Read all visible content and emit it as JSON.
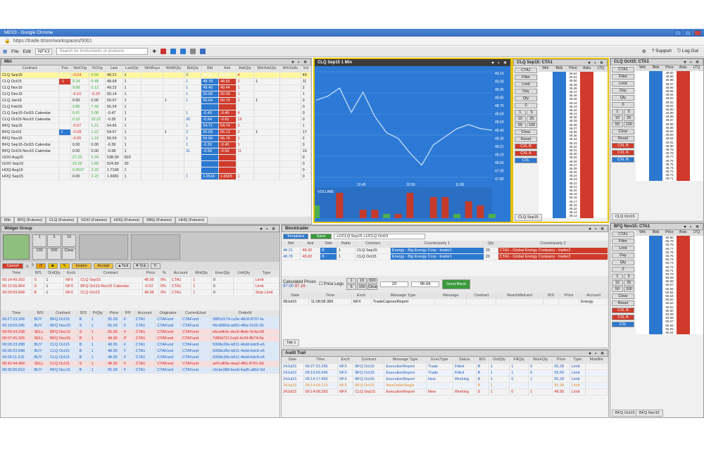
{
  "window": {
    "title": "MEX3 - Google Chrome",
    "url": "https://trade.tt/sim/workspaces/5061"
  },
  "appbar": {
    "menu_file": "File",
    "menu_edit": "Edit",
    "market": "NFX3",
    "search_placeholder": "Search for instruments or products",
    "support": "Support",
    "logout": "Log Out"
  },
  "mkt": {
    "title": "Mkt",
    "headers": [
      "Contract",
      "Pos",
      "NetChg",
      "%Chg",
      "Last",
      "LastQty",
      "WrkBuys",
      "WrkBQty",
      "BidQty",
      "Bid",
      "Ask",
      "AskQty",
      "WrkAskQty",
      "WrkSells",
      "Vol"
    ],
    "rows": [
      [
        "CLQ Sep15",
        "",
        "-0.24",
        "0.50",
        "48.21",
        "1",
        "",
        "",
        "3",
        "48.31",
        "48.34",
        "4",
        "",
        "",
        "40"
      ],
      [
        "CLQ Oct15",
        "-1",
        "0.24",
        "0.49",
        "48.68",
        "1",
        "",
        "",
        "1",
        "48.78",
        "48.82",
        "2",
        "1",
        "",
        "11"
      ],
      [
        "CLQ Nov15",
        "",
        "0.08",
        "0.12",
        "49.32",
        "1",
        "",
        "",
        "1",
        "49.40",
        "49.44",
        "1",
        "",
        "",
        "2"
      ],
      [
        "CLQ Dec15",
        "",
        "-0.10",
        "-0.20",
        "50.14",
        "1",
        "",
        "",
        "1",
        "50.05",
        "50.09",
        "1",
        "",
        "",
        "1"
      ],
      [
        "CLQ Jan16",
        "",
        "0.00",
        "0.00",
        "50.67",
        "1",
        "",
        "1",
        "1",
        "50.64",
        "50.70",
        "1",
        "1",
        "",
        "0"
      ],
      [
        "CLQ Feb16",
        "",
        "3.85",
        "7.49",
        "55.24",
        "1",
        "",
        "",
        "",
        "",
        "",
        "",
        "",
        "",
        "0"
      ],
      [
        "CLQ Sep15-Oct15 Calendar",
        "",
        "0.01",
        "2.08",
        "-0.47",
        "1",
        "",
        "",
        "1",
        "-0.40",
        "-0.40",
        "4",
        "",
        "",
        "0"
      ],
      [
        "CLQ Oct15-Nov15 Calendar",
        "",
        "0.10",
        "22.22",
        "-0.35",
        "1",
        "",
        "",
        "30",
        "-0.64",
        "-0.61",
        "16",
        "",
        "",
        "0"
      ],
      [
        "BFQ Sep15",
        "",
        "-0.07",
        "1.21",
        "54.66",
        "1",
        "",
        "",
        "1",
        "54.71",
        "54.74",
        "2",
        "",
        "",
        "1"
      ],
      [
        "BFQ Oct15",
        "2",
        "-0.08",
        "1.22",
        "54.67",
        "1",
        "",
        "1",
        "2",
        "55.09",
        "55.13",
        "2",
        "1",
        "",
        "17"
      ],
      [
        "BFQ Nov15",
        "",
        "-0.05",
        "1.19",
        "55.55",
        "1",
        "",
        "",
        "1",
        "55.50",
        "55.70",
        "1",
        "",
        "",
        "2"
      ],
      [
        "BFQ Sep15-Oct15 Calendar",
        "",
        "0.00",
        "0.00",
        "-0.39",
        "1",
        "",
        "",
        "1",
        "-0.30",
        "-0.40",
        "1",
        "",
        "",
        "0"
      ],
      [
        "BFQ Oct15-Nov15 Calendar",
        "",
        "0.00",
        "0.00",
        "-0.58",
        "1",
        "",
        "",
        "31",
        "-0.58",
        "-0.56",
        "11",
        "",
        "",
        "15"
      ],
      [
        "GOO Aug15",
        "",
        "27.25",
        "5.34",
        "538.00",
        "503",
        "",
        "",
        "",
        "",
        "",
        "",
        "",
        "",
        "0"
      ],
      [
        "GOO Sep15",
        "",
        "10.25",
        "1.89",
        "524.50",
        "20",
        "",
        "",
        "",
        "",
        "",
        "",
        "",
        "",
        "0"
      ],
      [
        "HOQ Aug15",
        "",
        "0.0537",
        "2.22",
        "1.7199",
        "1",
        "",
        "",
        "",
        "",
        "",
        "",
        "",
        "",
        "0"
      ],
      [
        "HOQ Sep15",
        "",
        "0.00",
        "2.22",
        "1.6081",
        "1",
        "",
        "",
        "1",
        "1.6516",
        "1.6525",
        "1",
        "",
        "",
        "0"
      ]
    ],
    "tabs": [
      "Mkt",
      "BFQ (Futures)",
      "CLQ (Futures)",
      "GOO (Futures)",
      "HOQ (Futures)",
      "RBQ (Futures)",
      "HHQ (Futures)"
    ]
  },
  "chart": {
    "title": "CLQ Sep15 1 Min",
    "ticks": [
      "49.10",
      "49.00",
      "48.90",
      "48.80",
      "48.70",
      "48.60",
      "48.50",
      "48.40",
      "48.30",
      "48.21",
      "48.10",
      "48.00",
      "47.90",
      "47.80"
    ],
    "volume_label": "VOLUME",
    "times": [
      "10:45",
      "10:50",
      "11:00"
    ]
  },
  "chart_data": {
    "type": "line",
    "x": [
      "10:40",
      "10:41",
      "10:42",
      "10:43",
      "10:44",
      "10:45",
      "10:46",
      "10:47",
      "10:48",
      "10:49",
      "10:50",
      "10:51",
      "10:52",
      "10:53",
      "10:54",
      "10:55"
    ],
    "values": [
      48.75,
      48.8,
      48.9,
      48.6,
      48.85,
      48.55,
      48.35,
      48.28,
      48.1,
      47.95,
      48.2,
      48.3,
      48.4,
      48.45,
      48.4,
      48.38
    ],
    "volume": [
      0,
      0,
      0,
      0,
      0,
      0,
      0,
      0,
      0,
      0,
      0,
      0,
      0,
      0,
      0,
      0
    ],
    "ylim": [
      47.8,
      49.1
    ]
  },
  "ladder1": {
    "title": "CLQ Sep15: CTA1",
    "prices": [
      "48.52",
      "48.51",
      "48.50",
      "48.49",
      "48.48",
      "48.47",
      "48.46",
      "48.45",
      "48.44",
      "48.43",
      "48.42",
      "48.41",
      "48.40",
      "48.39",
      "48.38",
      "48.37",
      "48.36",
      "48.35",
      "48.34",
      "48.33",
      "48.32",
      "48.31",
      "48.30",
      "48.29",
      "48.28",
      "48.27",
      "48.26",
      "48.25",
      "48.24",
      "48.23",
      "48.22",
      "48.21",
      "48.20",
      "48.19",
      "48.18",
      "48.17",
      "48.16",
      "48.15",
      "48.14",
      "48.13"
    ],
    "headers": [
      "Wrk",
      "Bids",
      "Price",
      "Asks",
      "LTQ"
    ],
    "acct": "CTA1",
    "filter": "Filter",
    "ordtype": "Limit",
    "tif": "Day",
    "qty_label": "Qty",
    "qty": "0",
    "q1": "1",
    "q5": "5",
    "q10": "10",
    "q25": "25",
    "q50": "50",
    "q100": "100",
    "clear": "Clear",
    "reset": "Reset",
    "cxlb": "CXL B",
    "cxla": "CXL A",
    "cxl": "CXL",
    "tab": "CLQ Sep15"
  },
  "ladder2": {
    "title": "CLQ Oct15: CTA1",
    "prices": [
      "49.00",
      "48.99",
      "48.98",
      "48.97",
      "48.96",
      "48.95",
      "48.94",
      "48.93",
      "48.92",
      "48.91",
      "48.90",
      "48.89",
      "48.88",
      "48.87",
      "48.86",
      "48.85",
      "48.84",
      "48.83",
      "48.82",
      "48.81",
      "48.80",
      "48.79",
      "48.78",
      "48.77",
      "48.76",
      "48.75",
      "48.74",
      "48.73",
      "48.72",
      "48.71"
    ],
    "headers": [
      "Wrk",
      "Bids",
      "Price",
      "Asks",
      "LTQ"
    ],
    "acct": "CTA1",
    "filter": "Filter",
    "ordtype": "Limit",
    "tif": "Day",
    "qty_label": "Qty",
    "qty": "0",
    "q1": "1",
    "q5": "5",
    "q10": "10",
    "q25": "25",
    "q50": "50",
    "q100": "100",
    "clear": "Clear",
    "reset": "Reset",
    "cxlb": "CXL B",
    "cxla": "CXL A",
    "cxl": "CXL B",
    "tab": "CLQ Oct15"
  },
  "ladder3": {
    "title": "BFQ Nov15: CTA1",
    "prices": [
      "55.80",
      "55.79",
      "55.78",
      "55.77",
      "55.76",
      "55.75",
      "55.74",
      "55.73",
      "55.72",
      "55.71",
      "55.70",
      "55.69",
      "55.68",
      "55.67",
      "55.66",
      "55.65",
      "55.64",
      "55.63",
      "55.62",
      "55.61",
      "55.60",
      "55.59",
      "55.58",
      "55.57",
      "55.56",
      "55.55",
      "55.54"
    ],
    "headers": [
      "Wrk",
      "Bids",
      "Price",
      "Asks",
      "LTQ"
    ],
    "acct": "CTA1",
    "filter": "Filter",
    "ordtype": "Limit",
    "tif": "Day",
    "qty_label": "Qty",
    "qty": "0",
    "q1": "1",
    "q5": "5",
    "q10": "10",
    "q25": "25",
    "q50": "50",
    "q100": "100",
    "clear": "Clear",
    "reset": "Reset",
    "cxlb": "CXL B",
    "cxla": "CXL A",
    "cxl": "CXL",
    "tabs": [
      "BFQ Oct15",
      "BFQ Nov15"
    ]
  },
  "widget": {
    "title": "Widget Group",
    "q": [
      "1",
      "5",
      "10",
      "100",
      "500"
    ],
    "clear": "Clear",
    "cancel": "Cancel",
    "inspire": "Inspire",
    "accept": "Accept",
    "tick_up": "Tick",
    "tick_dn": "Tick",
    "headers": [
      "Time",
      "B/S",
      "OrdQty",
      "Exch",
      "Contract",
      "Price",
      "%",
      "Account",
      "WrkQty",
      "ExecQty",
      "UnitQty",
      "Type"
    ],
    "rows": [
      [
        "09:14:49.303",
        "S",
        "1",
        "NFX",
        "CLQ Sep15",
        "48.95",
        "0%",
        "CTA1",
        "1",
        "0",
        "",
        "Limit"
      ],
      [
        "09:12:55.854",
        "S",
        "1",
        "NFX",
        "BFQ Oct15-Nov15 Calendar",
        "-0.52",
        "0%",
        "CTA1",
        "1",
        "0",
        "",
        "Limit"
      ],
      [
        "09:09:59.848",
        "B",
        "1",
        "NFX",
        "CLQ Oct15",
        "48.95",
        "0%",
        "CTA1",
        "1",
        "0",
        "",
        "Stop Limit"
      ]
    ]
  },
  "fills": {
    "headers": [
      "Time",
      "B/S",
      "Contract",
      "B/S",
      "PrQty",
      "Price",
      "P/F",
      "Account",
      "Originator",
      "CurrentUser",
      "OrderId"
    ],
    "rows": [
      [
        "09:27:23.266",
        "BUY",
        "BFQ Oct15",
        "B",
        "1",
        "55.28",
        "F",
        "CTA1",
        "CTAFund",
        "CTAFund",
        "3881d174-ca3e-48c8-8707-fa"
      ],
      [
        "09:19:59.945",
        "BUY",
        "BFQ Nov15",
        "S",
        "1",
        "55.56",
        "F",
        "CTA1",
        "CTAFund",
        "CTAFund",
        "45c8885d-a650-4f6a-9102-00"
      ],
      [
        "09:06:34.338",
        "SELL",
        "BFQ Nov15",
        "S",
        "1",
        "55.56",
        "F",
        "CTA1",
        "CTAFund",
        "CTAFund",
        "e6ca4b3c-dec8-4bdc-9c4a-68"
      ],
      [
        "09:07:41.326",
        "SELL",
        "BFQ Nov15",
        "B",
        "1",
        "48.95",
        "P",
        "CTA1",
        "CTAFund",
        "CTAFund",
        "7d90d71f-2ca0-4c34-8b74-0a"
      ],
      [
        "09:05:23.288",
        "BUY",
        "CLQ Oct15",
        "B",
        "1",
        "48.95",
        "F",
        "CTA1",
        "CTAFund",
        "CTAFund",
        "5008e28e-b811-4bdd-bdc8-e6"
      ],
      [
        "09:06:23.848",
        "BUY",
        "CLQ Oct15",
        "B",
        "1",
        "48.95",
        "F",
        "CTA1",
        "CTAFund",
        "CTAFund",
        "5008e28e-b811-4bdd-bdc8-e6"
      ],
      [
        "09:06:11.316",
        "BUY",
        "CLQ Oct15",
        "B",
        "1",
        "48.95",
        "F",
        "CTA1",
        "CTAFund",
        "CTAFund",
        "5008e28e-b811-4bdd-bdc8-e6"
      ],
      [
        "08:42:44.484",
        "SELL",
        "CLQ Oct15",
        "S",
        "1",
        "48.95",
        "F",
        "CTA1",
        "CTAFund",
        "CTAFund",
        "a47cd69e-4ea2-4f0c-8781-9d"
      ],
      [
        "08:36:55.813",
        "BUY",
        "BFQ Nov15",
        "B",
        "1",
        "55.28",
        "F",
        "CTA1",
        "CTAFund",
        "CTAFund",
        "c9cbe388-bee8-4ad5-a8b2-6d"
      ]
    ]
  },
  "block": {
    "title": "Blocktrader",
    "templates": "Templates",
    "save": "Save",
    "spread": "+1/CLQ Sep15 +1/CLQ Oct15",
    "headers": [
      "Bid",
      "Ask",
      "Side",
      "Ratio",
      "Contract",
      "Counterparty 1",
      "Qty",
      "Counterparty 2"
    ],
    "rows": [
      [
        "48.21",
        "48.32",
        "B",
        "1",
        "CLQ Sep15",
        "Energy - Big Energy Corp - trader1",
        "20",
        "CTA1 - Global Energy Company - trader2"
      ],
      [
        "48.78",
        "48.82",
        "B",
        "1",
        "CLQ Oct15",
        "Energy - Big Energy Corp - trader1",
        "20",
        "CTA1 - Global Energy Company - trader2"
      ]
    ],
    "calc_label": "Calculated Prices",
    "calc1": "97.00",
    "calc2": "97.16",
    "price_legs": "Price Legs",
    "qty_a": "20",
    "price_a": "96.84",
    "q1": "1",
    "q10": "10",
    "q500": "500",
    "q5": "5",
    "q100": "100",
    "clear": "Clear",
    "send": "Send Block",
    "msg_headers": [
      "Date",
      "Time",
      "Exch",
      "Message Type",
      "Message",
      "Contract",
      "ReachMsIcerd",
      "B/S",
      "Price",
      "Account"
    ],
    "msg_row": [
      "08Jul15",
      "11:08:08.389",
      "NFX",
      "TradeCaptureReport",
      "",
      "",
      "",
      "",
      "",
      "Energy"
    ],
    "tab": "Tab 1"
  },
  "audit": {
    "title": "Audit Trail",
    "headers": [
      "Date",
      "Time",
      "Exch",
      "Contract",
      "Message Type",
      "ExecType",
      "Status",
      "B/S",
      "OrdQty",
      "FillQty",
      "WorkQty",
      "Price",
      "Type",
      "Modifier"
    ],
    "rows": [
      [
        "24Jul15",
        "09:27:23.266",
        "NFX",
        "BFQ Oct15",
        "ExecutionReport",
        "Trade",
        "Filled",
        "B",
        "1",
        "1",
        "0",
        "55.28",
        "Limit",
        ""
      ],
      [
        "24Jul15",
        "09:19:59.945",
        "NFX",
        "BFQ Oct15",
        "ExecutionReport",
        "Trade",
        "Filled",
        "B",
        "1",
        "1",
        "0",
        "55.56",
        "Limit",
        ""
      ],
      [
        "24Jul15",
        "09:14:17.450",
        "NFX",
        "BFQ Oct15",
        "ExecutionReport",
        "New",
        "Working",
        "B",
        "1",
        "0",
        "1",
        "55.28",
        "Limit",
        ""
      ],
      [
        "24Jul15",
        "09:14:09.123",
        "NFX",
        "BFQ Oct15",
        "NewOrderSingle",
        "",
        "",
        "B",
        "1",
        "",
        "",
        "55.28",
        "Limit",
        ""
      ],
      [
        "24Jul15",
        "09:14:08.393",
        "NFX",
        "CLQ Sep15",
        "ExecutionReport",
        "New",
        "Working",
        "S",
        "1",
        "0",
        "1",
        "48.95",
        "Limit",
        ""
      ]
    ]
  },
  "colors": {
    "bid": "#2b78d0",
    "ask": "#d03a2a",
    "chart_bg": "#2d7ad6"
  }
}
